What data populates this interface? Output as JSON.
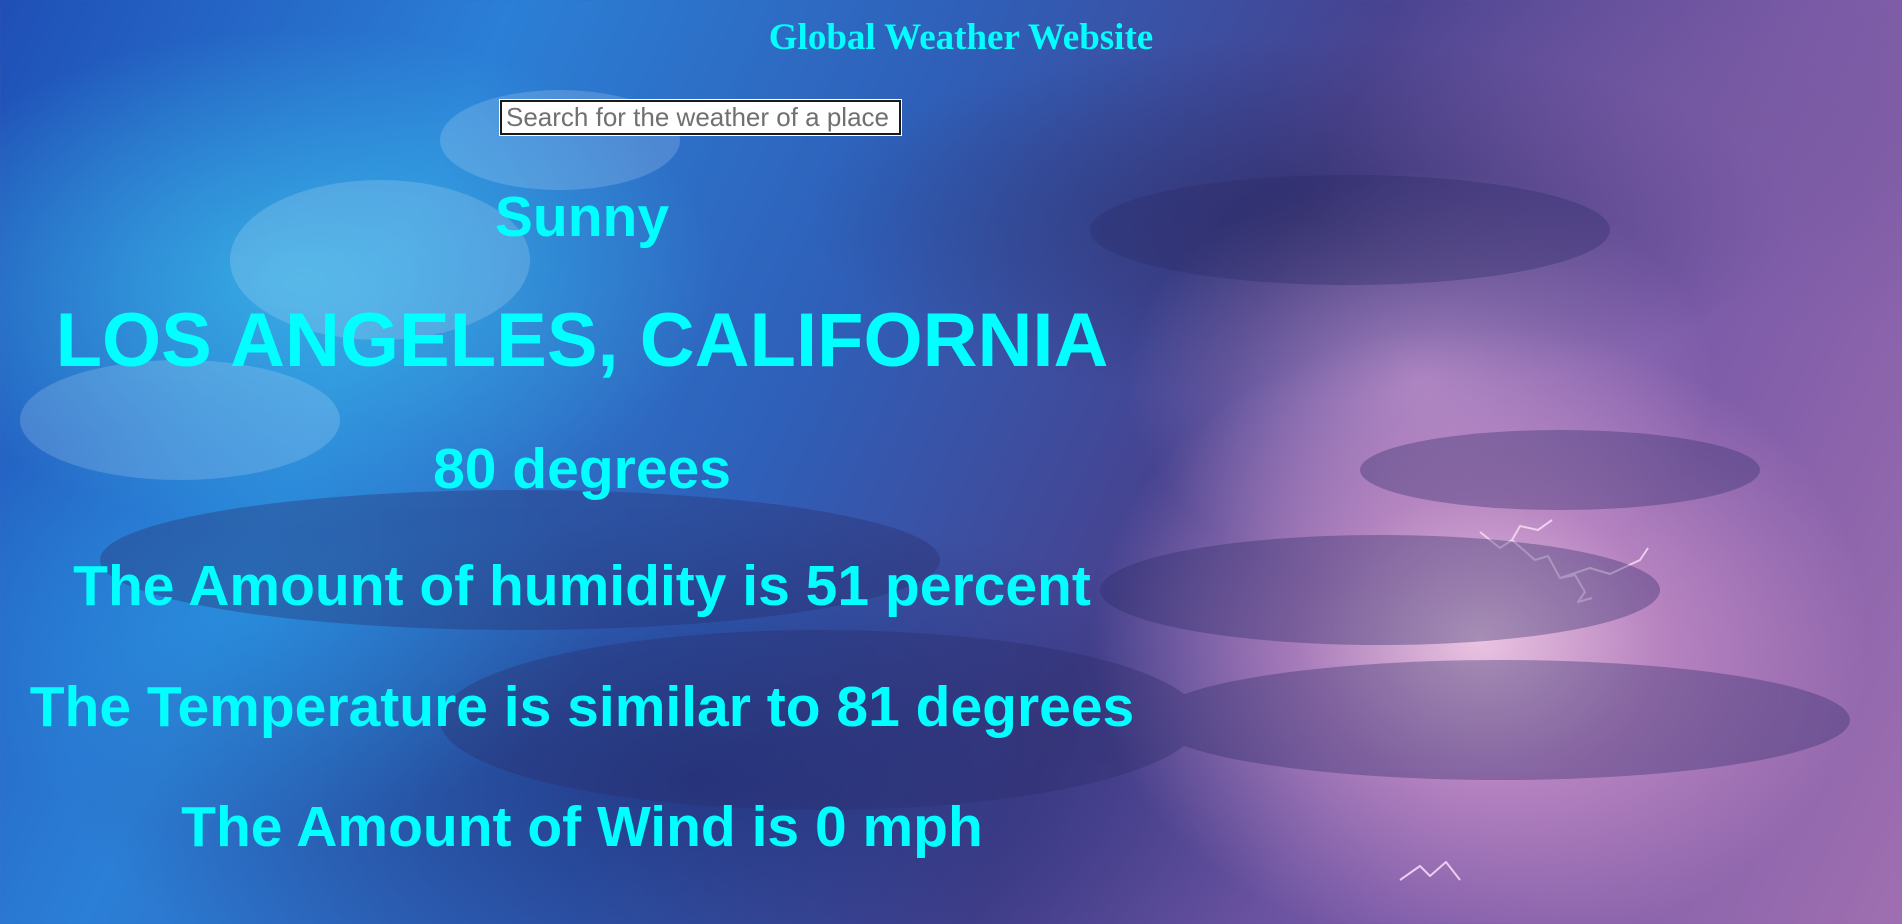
{
  "header": {
    "title": "Global Weather Website"
  },
  "search": {
    "placeholder": "Search for the weather of a place",
    "value": ""
  },
  "weather": {
    "condition": "Sunny",
    "location": "LOS ANGELES, CALIFORNIA",
    "temperature": "80 degrees",
    "humidity": "The Amount of humidity is 51 percent",
    "feels_like": "The Temperature is similar to 81 degrees",
    "wind": "The Amount of Wind is 0 mph"
  },
  "colors": {
    "text": "#00ffff",
    "background": "stormy-sky-blue-purple"
  }
}
